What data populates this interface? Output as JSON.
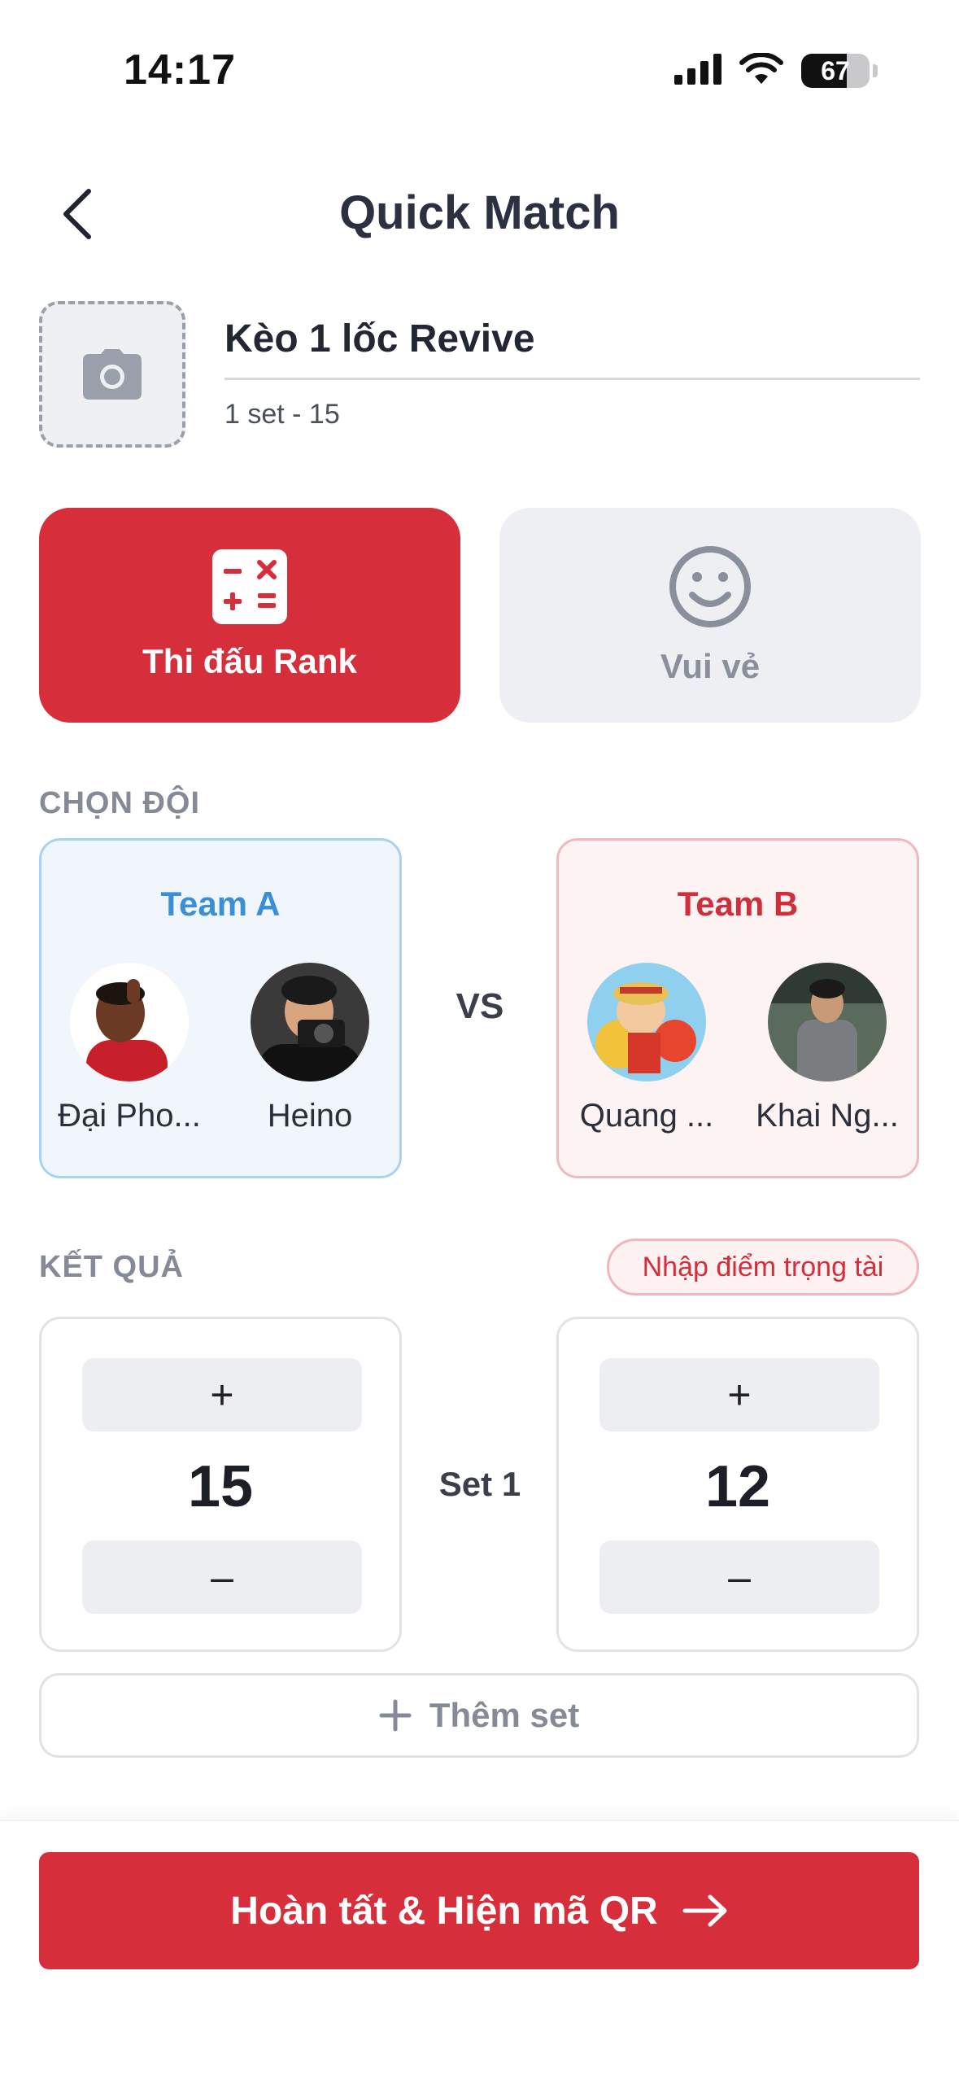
{
  "status_bar": {
    "time": "14:17",
    "battery": "67",
    "battery_level": 0.67
  },
  "header": {
    "title": "Quick Match",
    "back_icon": "chevron-left-icon"
  },
  "match": {
    "name": "Kèo 1 lốc Revive",
    "subtitle": "1 set - 15",
    "photo_icon": "camera-icon"
  },
  "modes": [
    {
      "label": "Thi đấu Rank",
      "icon": "calculator-icon",
      "selected": true
    },
    {
      "label": "Vui vẻ",
      "icon": "smiley-icon",
      "selected": false
    }
  ],
  "teams_section": {
    "label": "CHỌN ĐỘI",
    "vs": "VS",
    "team_a": {
      "name": "Team A",
      "players": [
        "Đại Pho...",
        "Heino"
      ]
    },
    "team_b": {
      "name": "Team B",
      "players": [
        "Quang ...",
        "Khai Ng..."
      ]
    }
  },
  "results": {
    "label": "KẾT QUẢ",
    "referee_button": "Nhập điểm trọng tài",
    "set_label": "Set 1",
    "score_a": "15",
    "score_b": "12",
    "plus": "+",
    "minus": "–",
    "add_set": "Thêm set"
  },
  "footer": {
    "finish_button": "Hoàn tất & Hiện mã QR"
  },
  "colors": {
    "brand_red": "#d62e3a",
    "team_a_blue": "#3b8fd6",
    "team_b_red": "#cf2f3c"
  }
}
